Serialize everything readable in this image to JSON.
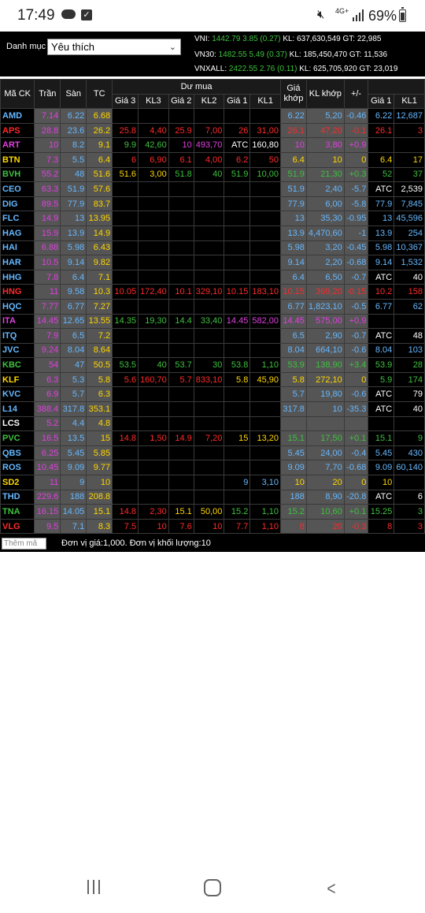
{
  "status": {
    "time": "17:49",
    "network": "4G+",
    "battery": "69%"
  },
  "watchlist": {
    "label": "Danh mục",
    "selected": "Yêu thích"
  },
  "indices": [
    {
      "name": "VNI:",
      "value": "1442.79",
      "change": "3.85 (0.27)",
      "vol": "KL: 637,630,549",
      "gt": "GT: 22,985"
    },
    {
      "name": "VN30:",
      "value": "1482.55",
      "change": "5.49 (0.37)",
      "vol": "KL: 185,450,470",
      "gt": "GT: 11,536"
    },
    {
      "name": "VNXALL:",
      "value": "2422.55",
      "change": "2.76 (0.11)",
      "vol": "KL: 625,705,920",
      "gt": "GT: 23,019"
    }
  ],
  "columns": {
    "symbol": "Mã CK",
    "ceil": "Trần",
    "floor": "Sàn",
    "ref": "TC",
    "bid_group": "Dư mua",
    "bid": [
      "Giá 3",
      "KL3",
      "Giá 2",
      "KL2",
      "Giá 1",
      "KL1"
    ],
    "match_price": "Giá khớp",
    "match_vol": "KL khớp",
    "change": "+/-",
    "ask": [
      "Giá 1",
      "KL1"
    ]
  },
  "colors": {
    "ceil": "#e040e0",
    "floor": "#66b8ff",
    "ref": "#ffd700",
    "up": "#3ec13e",
    "down": "#ff2a2a",
    "white": "#ffffff"
  },
  "rows": [
    {
      "s": "AMD",
      "c": "7.14",
      "f": "6.22",
      "r": "6.68",
      "b": [
        "",
        "",
        "",
        "",
        "",
        ""
      ],
      "bc": [
        "",
        "",
        "",
        "",
        "",
        ""
      ],
      "mp": "6.22",
      "mv": "5,20",
      "ch": "-0.46",
      "mc": "floor",
      "a": [
        "6.22",
        "12,687"
      ],
      "ac": [
        "floor",
        "floor"
      ],
      "sc": "floor"
    },
    {
      "s": "APS",
      "c": "28.8",
      "f": "23.6",
      "r": "26.2",
      "b": [
        "25.8",
        "4,40",
        "25.9",
        "7,00",
        "26",
        "31,00"
      ],
      "bc": [
        "down",
        "down",
        "down",
        "down",
        "down",
        "down"
      ],
      "mp": "26.1",
      "mv": "47,20",
      "ch": "-0.1",
      "mc": "down",
      "a": [
        "26.1",
        "3"
      ],
      "ac": [
        "down",
        "down"
      ],
      "sc": "down"
    },
    {
      "s": "ART",
      "c": "10",
      "f": "8.2",
      "r": "9.1",
      "b": [
        "9.9",
        "42,60",
        "10",
        "493,70",
        "ATC",
        "160,80"
      ],
      "bc": [
        "up",
        "up",
        "ceil",
        "ceil",
        "white",
        "white"
      ],
      "mp": "10",
      "mv": "3,80",
      "ch": "+0.9",
      "mc": "ceil",
      "a": [
        "",
        ""
      ],
      "ac": [
        "",
        ""
      ],
      "sc": "ceil"
    },
    {
      "s": "BTN",
      "c": "7.3",
      "f": "5.5",
      "r": "6.4",
      "b": [
        "6",
        "6,90",
        "6.1",
        "4,00",
        "6.2",
        "50"
      ],
      "bc": [
        "down",
        "down",
        "down",
        "down",
        "down",
        "down"
      ],
      "mp": "6.4",
      "mv": "10",
      "ch": "0",
      "mc": "ref",
      "a": [
        "6.4",
        "17"
      ],
      "ac": [
        "ref",
        "ref"
      ],
      "sc": "ref"
    },
    {
      "s": "BVH",
      "c": "55.2",
      "f": "48",
      "r": "51.6",
      "b": [
        "51.6",
        "3,00",
        "51.8",
        "40",
        "51.9",
        "10,00"
      ],
      "bc": [
        "ref",
        "ref",
        "up",
        "up",
        "up",
        "up"
      ],
      "mp": "51.9",
      "mv": "21,30",
      "ch": "+0.3",
      "mc": "up",
      "a": [
        "52",
        "37"
      ],
      "ac": [
        "up",
        "up"
      ],
      "sc": "up"
    },
    {
      "s": "CEO",
      "c": "63.3",
      "f": "51.9",
      "r": "57.6",
      "b": [
        "",
        "",
        "",
        "",
        "",
        ""
      ],
      "bc": [
        "",
        "",
        "",
        "",
        "",
        ""
      ],
      "mp": "51.9",
      "mv": "2,40",
      "ch": "-5.7",
      "mc": "floor",
      "a": [
        "ATC",
        "2,539"
      ],
      "ac": [
        "white",
        "white"
      ],
      "sc": "floor"
    },
    {
      "s": "DIG",
      "c": "89.5",
      "f": "77.9",
      "r": "83.7",
      "b": [
        "",
        "",
        "",
        "",
        "",
        ""
      ],
      "bc": [
        "",
        "",
        "",
        "",
        "",
        ""
      ],
      "mp": "77.9",
      "mv": "6,00",
      "ch": "-5.8",
      "mc": "floor",
      "a": [
        "77.9",
        "7,845"
      ],
      "ac": [
        "floor",
        "floor"
      ],
      "sc": "floor"
    },
    {
      "s": "FLC",
      "c": "14.9",
      "f": "13",
      "r": "13.95",
      "b": [
        "",
        "",
        "",
        "",
        "",
        ""
      ],
      "bc": [
        "",
        "",
        "",
        "",
        "",
        ""
      ],
      "mp": "13",
      "mv": "35,30",
      "ch": "-0.95",
      "mc": "floor",
      "a": [
        "13",
        "45,596"
      ],
      "ac": [
        "floor",
        "floor"
      ],
      "sc": "floor"
    },
    {
      "s": "HAG",
      "c": "15.9",
      "f": "13.9",
      "r": "14.9",
      "b": [
        "",
        "",
        "",
        "",
        "",
        ""
      ],
      "bc": [
        "",
        "",
        "",
        "",
        "",
        ""
      ],
      "mp": "13.9",
      "mv": "4,470,60",
      "ch": "-1",
      "mc": "floor",
      "a": [
        "13.9",
        "254"
      ],
      "ac": [
        "floor",
        "floor"
      ],
      "sc": "floor"
    },
    {
      "s": "HAI",
      "c": "6.88",
      "f": "5.98",
      "r": "6.43",
      "b": [
        "",
        "",
        "",
        "",
        "",
        ""
      ],
      "bc": [
        "",
        "",
        "",
        "",
        "",
        ""
      ],
      "mp": "5.98",
      "mv": "3,20",
      "ch": "-0.45",
      "mc": "floor",
      "a": [
        "5.98",
        "10,367"
      ],
      "ac": [
        "floor",
        "floor"
      ],
      "sc": "floor"
    },
    {
      "s": "HAR",
      "c": "10.5",
      "f": "9.14",
      "r": "9.82",
      "b": [
        "",
        "",
        "",
        "",
        "",
        ""
      ],
      "bc": [
        "",
        "",
        "",
        "",
        "",
        ""
      ],
      "mp": "9.14",
      "mv": "2,20",
      "ch": "-0.68",
      "mc": "floor",
      "a": [
        "9.14",
        "1,532"
      ],
      "ac": [
        "floor",
        "floor"
      ],
      "sc": "floor"
    },
    {
      "s": "HHG",
      "c": "7.8",
      "f": "6.4",
      "r": "7.1",
      "b": [
        "",
        "",
        "",
        "",
        "",
        ""
      ],
      "bc": [
        "",
        "",
        "",
        "",
        "",
        ""
      ],
      "mp": "6.4",
      "mv": "6,50",
      "ch": "-0.7",
      "mc": "floor",
      "a": [
        "ATC",
        "40"
      ],
      "ac": [
        "white",
        "white"
      ],
      "sc": "floor"
    },
    {
      "s": "HNG",
      "c": "11",
      "f": "9.58",
      "r": "10.3",
      "b": [
        "10.05",
        "172,40",
        "10.1",
        "329,10",
        "10.15",
        "183,10"
      ],
      "bc": [
        "down",
        "down",
        "down",
        "down",
        "down",
        "down"
      ],
      "mp": "10.15",
      "mv": "369,20",
      "ch": "-0.15",
      "mc": "down",
      "a": [
        "10.2",
        "158"
      ],
      "ac": [
        "down",
        "down"
      ],
      "sc": "down"
    },
    {
      "s": "HQC",
      "c": "7.77",
      "f": "6.77",
      "r": "7.27",
      "b": [
        "",
        "",
        "",
        "",
        "",
        ""
      ],
      "bc": [
        "",
        "",
        "",
        "",
        "",
        ""
      ],
      "mp": "6.77",
      "mv": "1,823,10",
      "ch": "-0.5",
      "mc": "floor",
      "a": [
        "6.77",
        "62"
      ],
      "ac": [
        "floor",
        "floor"
      ],
      "sc": "floor"
    },
    {
      "s": "ITA",
      "c": "14.45",
      "f": "12.65",
      "r": "13.55",
      "b": [
        "14.35",
        "19,30",
        "14.4",
        "33,40",
        "14.45",
        "582,00"
      ],
      "bc": [
        "up",
        "up",
        "up",
        "up",
        "ceil",
        "ceil"
      ],
      "mp": "14.45",
      "mv": "575,00",
      "ch": "+0.9",
      "mc": "ceil",
      "a": [
        "",
        ""
      ],
      "ac": [
        "",
        ""
      ],
      "sc": "ceil"
    },
    {
      "s": "ITQ",
      "c": "7.9",
      "f": "6.5",
      "r": "7.2",
      "b": [
        "",
        "",
        "",
        "",
        "",
        ""
      ],
      "bc": [
        "",
        "",
        "",
        "",
        "",
        ""
      ],
      "mp": "6.5",
      "mv": "2,90",
      "ch": "-0.7",
      "mc": "floor",
      "a": [
        "ATC",
        "48"
      ],
      "ac": [
        "white",
        "white"
      ],
      "sc": "floor"
    },
    {
      "s": "JVC",
      "c": "9.24",
      "f": "8.04",
      "r": "8.64",
      "b": [
        "",
        "",
        "",
        "",
        "",
        ""
      ],
      "bc": [
        "",
        "",
        "",
        "",
        "",
        ""
      ],
      "mp": "8.04",
      "mv": "664,10",
      "ch": "-0.6",
      "mc": "floor",
      "a": [
        "8.04",
        "103"
      ],
      "ac": [
        "floor",
        "floor"
      ],
      "sc": "floor"
    },
    {
      "s": "KBC",
      "c": "54",
      "f": "47",
      "r": "50.5",
      "b": [
        "53.5",
        "40",
        "53.7",
        "30",
        "53.8",
        "1,10"
      ],
      "bc": [
        "up",
        "up",
        "up",
        "up",
        "up",
        "up"
      ],
      "mp": "53.9",
      "mv": "138,90",
      "ch": "+3.4",
      "mc": "up",
      "a": [
        "53.9",
        "28"
      ],
      "ac": [
        "up",
        "up"
      ],
      "sc": "up"
    },
    {
      "s": "KLF",
      "c": "6.3",
      "f": "5.3",
      "r": "5.8",
      "b": [
        "5.6",
        "160,70",
        "5.7",
        "833,10",
        "5.8",
        "45,90"
      ],
      "bc": [
        "down",
        "down",
        "down",
        "down",
        "ref",
        "ref"
      ],
      "mp": "5.8",
      "mv": "272,10",
      "ch": "0",
      "mc": "ref",
      "a": [
        "5.9",
        "174"
      ],
      "ac": [
        "up",
        "up"
      ],
      "sc": "ref"
    },
    {
      "s": "KVC",
      "c": "6.9",
      "f": "5.7",
      "r": "6.3",
      "b": [
        "",
        "",
        "",
        "",
        "",
        ""
      ],
      "bc": [
        "",
        "",
        "",
        "",
        "",
        ""
      ],
      "mp": "5.7",
      "mv": "19,80",
      "ch": "-0.6",
      "mc": "floor",
      "a": [
        "ATC",
        "79"
      ],
      "ac": [
        "white",
        "white"
      ],
      "sc": "floor"
    },
    {
      "s": "L14",
      "c": "388.4",
      "f": "317.8",
      "r": "353.1",
      "b": [
        "",
        "",
        "",
        "",
        "",
        ""
      ],
      "bc": [
        "",
        "",
        "",
        "",
        "",
        ""
      ],
      "mp": "317.8",
      "mv": "10",
      "ch": "-35.3",
      "mc": "floor",
      "a": [
        "ATC",
        "40"
      ],
      "ac": [
        "white",
        "white"
      ],
      "sc": "floor"
    },
    {
      "s": "LCS",
      "c": "5.2",
      "f": "4.4",
      "r": "4.8",
      "b": [
        "",
        "",
        "",
        "",
        "",
        ""
      ],
      "bc": [
        "",
        "",
        "",
        "",
        "",
        ""
      ],
      "mp": "",
      "mv": "",
      "ch": "",
      "mc": "ref",
      "a": [
        "",
        ""
      ],
      "ac": [
        "",
        ""
      ],
      "sc": "white"
    },
    {
      "s": "PVC",
      "c": "16.5",
      "f": "13.5",
      "r": "15",
      "b": [
        "14.8",
        "1,50",
        "14.9",
        "7,20",
        "15",
        "13,20"
      ],
      "bc": [
        "down",
        "down",
        "down",
        "down",
        "ref",
        "ref"
      ],
      "mp": "15.1",
      "mv": "17,50",
      "ch": "+0.1",
      "mc": "up",
      "a": [
        "15.1",
        "9"
      ],
      "ac": [
        "up",
        "up"
      ],
      "sc": "up"
    },
    {
      "s": "QBS",
      "c": "6.25",
      "f": "5.45",
      "r": "5.85",
      "b": [
        "",
        "",
        "",
        "",
        "",
        ""
      ],
      "bc": [
        "",
        "",
        "",
        "",
        "",
        ""
      ],
      "mp": "5.45",
      "mv": "24,00",
      "ch": "-0.4",
      "mc": "floor",
      "a": [
        "5.45",
        "430"
      ],
      "ac": [
        "floor",
        "floor"
      ],
      "sc": "floor"
    },
    {
      "s": "ROS",
      "c": "10.45",
      "f": "9.09",
      "r": "9.77",
      "b": [
        "",
        "",
        "",
        "",
        "",
        ""
      ],
      "bc": [
        "",
        "",
        "",
        "",
        "",
        ""
      ],
      "mp": "9.09",
      "mv": "7,70",
      "ch": "-0.68",
      "mc": "floor",
      "a": [
        "9.09",
        "60,140"
      ],
      "ac": [
        "floor",
        "floor"
      ],
      "sc": "floor"
    },
    {
      "s": "SD2",
      "c": "11",
      "f": "9",
      "r": "10",
      "b": [
        "",
        "",
        "",
        "",
        "9",
        "3,10"
      ],
      "bc": [
        "",
        "",
        "",
        "",
        "floor",
        "floor"
      ],
      "mp": "10",
      "mv": "20",
      "ch": "0",
      "mc": "ref",
      "a": [
        "10",
        ""
      ],
      "ac": [
        "ref",
        "ref"
      ],
      "sc": "ref"
    },
    {
      "s": "THD",
      "c": "229.6",
      "f": "188",
      "r": "208.8",
      "b": [
        "",
        "",
        "",
        "",
        "",
        ""
      ],
      "bc": [
        "",
        "",
        "",
        "",
        "",
        ""
      ],
      "mp": "188",
      "mv": "8,90",
      "ch": "-20.8",
      "mc": "floor",
      "a": [
        "ATC",
        "6"
      ],
      "ac": [
        "white",
        "white"
      ],
      "sc": "floor"
    },
    {
      "s": "TNA",
      "c": "16.15",
      "f": "14.05",
      "r": "15.1",
      "b": [
        "14.8",
        "2,30",
        "15.1",
        "50,00",
        "15.2",
        "1,10"
      ],
      "bc": [
        "down",
        "down",
        "ref",
        "ref",
        "up",
        "up"
      ],
      "mp": "15.2",
      "mv": "10,60",
      "ch": "+0.1",
      "mc": "up",
      "a": [
        "15.25",
        "3"
      ],
      "ac": [
        "up",
        "up"
      ],
      "sc": "up"
    },
    {
      "s": "VLG",
      "c": "9.5",
      "f": "7.1",
      "r": "8.3",
      "b": [
        "7.5",
        "10",
        "7.6",
        "10",
        "7.7",
        "1,10"
      ],
      "bc": [
        "down",
        "down",
        "down",
        "down",
        "down",
        "down"
      ],
      "mp": "8",
      "mv": "20",
      "ch": "-0.3",
      "mc": "down",
      "a": [
        "8",
        "3"
      ],
      "ac": [
        "down",
        "down"
      ],
      "sc": "down"
    }
  ],
  "footer": {
    "add_placeholder": "Thêm mã",
    "unit_note": "Đơn vị giá:1,000. Đơn vị khối lượng:10"
  }
}
